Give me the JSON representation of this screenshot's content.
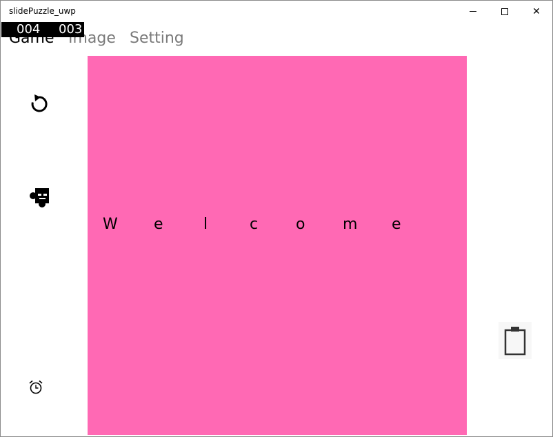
{
  "window": {
    "title": "slidePuzzle_uwp",
    "controls": {
      "minimize_icon": "minimize-icon",
      "maximize_icon": "maximize-icon",
      "close_glyph": "✕"
    }
  },
  "counter": {
    "moves": "004",
    "time": "003"
  },
  "menu": {
    "items": [
      {
        "label": "Game",
        "selected": true
      },
      {
        "label": "Image",
        "selected": false
      },
      {
        "label": "Setting",
        "selected": false
      }
    ]
  },
  "toolbar": {
    "refresh_icon": "refresh-icon",
    "puzzle_icon": "puzzle-icon",
    "alarm_icon": "alarm-clock-icon"
  },
  "board": {
    "background": "#ff69b4",
    "welcome_letters": [
      "W",
      "e",
      "l",
      "c",
      "o",
      "m",
      "e"
    ]
  },
  "clipboard": {
    "icon": "clipboard-icon"
  }
}
